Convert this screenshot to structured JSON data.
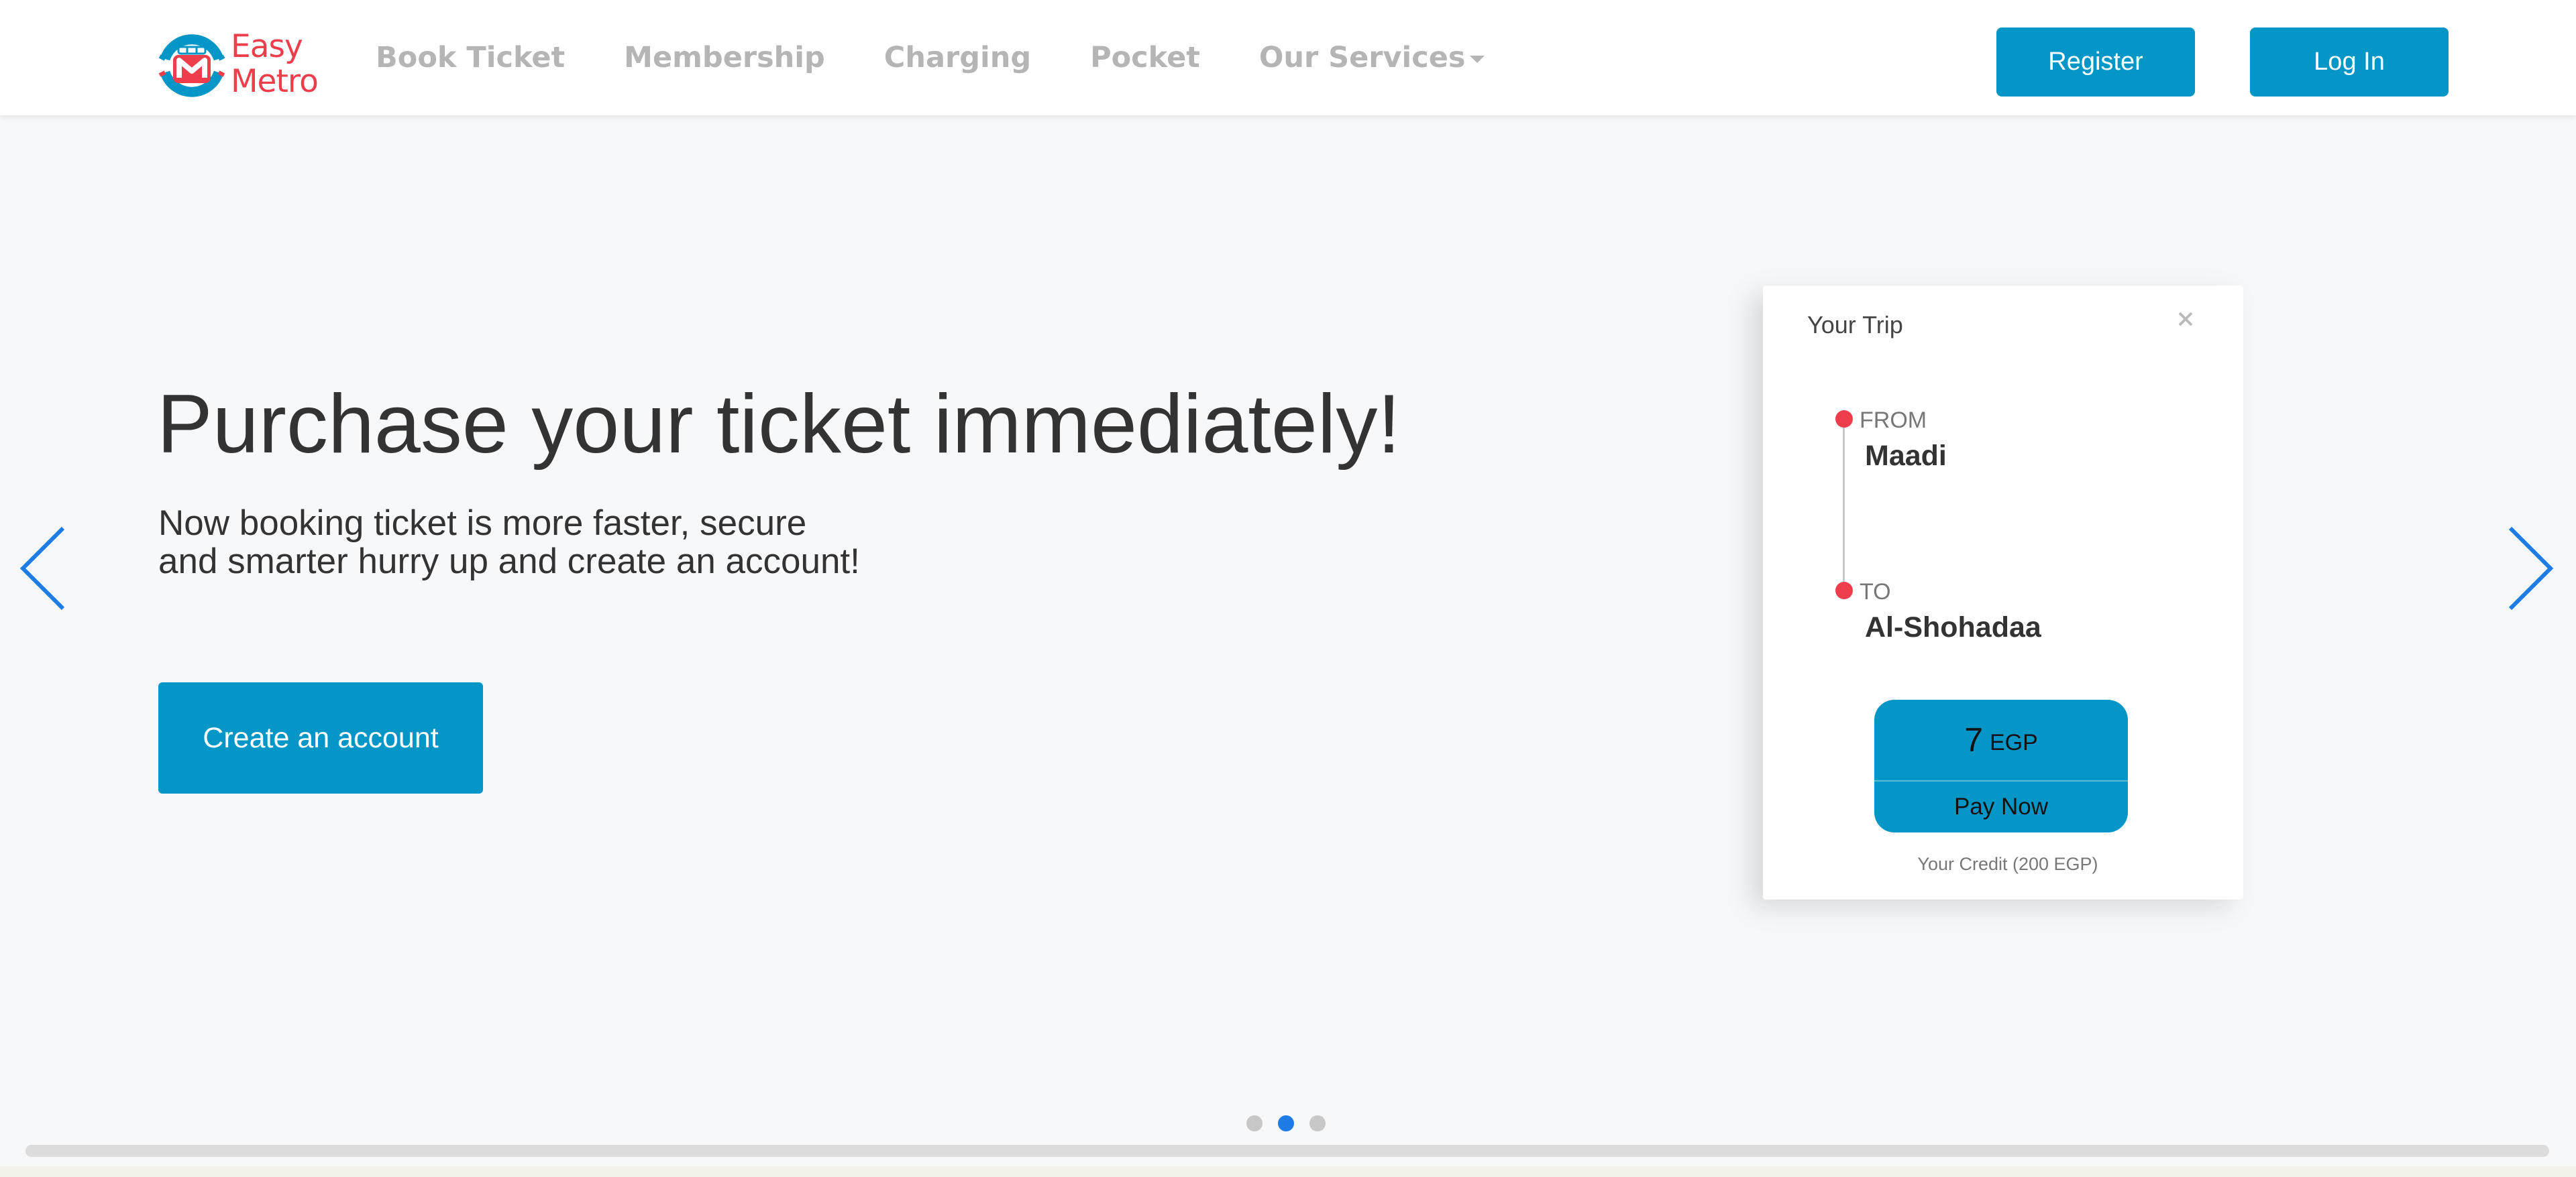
{
  "brand": {
    "line1": "Easy",
    "line2": "Metro",
    "icon": "metro-m-logo-icon",
    "colors": {
      "red": "#ee3d4b",
      "blue": "#0396c7"
    }
  },
  "nav": {
    "links": [
      "Book Ticket",
      "Membership",
      "Charging",
      "Pocket",
      "Our Services"
    ],
    "register": "Register",
    "login": "Log In"
  },
  "hero": {
    "title": "Purchase your ticket immediately!",
    "subtitle_line1": "Now booking ticket is more faster, secure",
    "subtitle_line2": "and smarter hurry up and create an account!",
    "cta": "Create an account"
  },
  "trip": {
    "title": "Your Trip",
    "from_label": "FROM",
    "from_station": "Maadi",
    "to_label": "TO",
    "to_station": "Al-Shohadaa",
    "price": "7",
    "currency": "EGP",
    "pay_label": "Pay Now",
    "credit": "Your Credit (200 EGP)"
  },
  "carousel": {
    "slides": 3,
    "active_index": 1,
    "prev_icon": "chevron-left-icon",
    "next_icon": "chevron-right-icon"
  }
}
